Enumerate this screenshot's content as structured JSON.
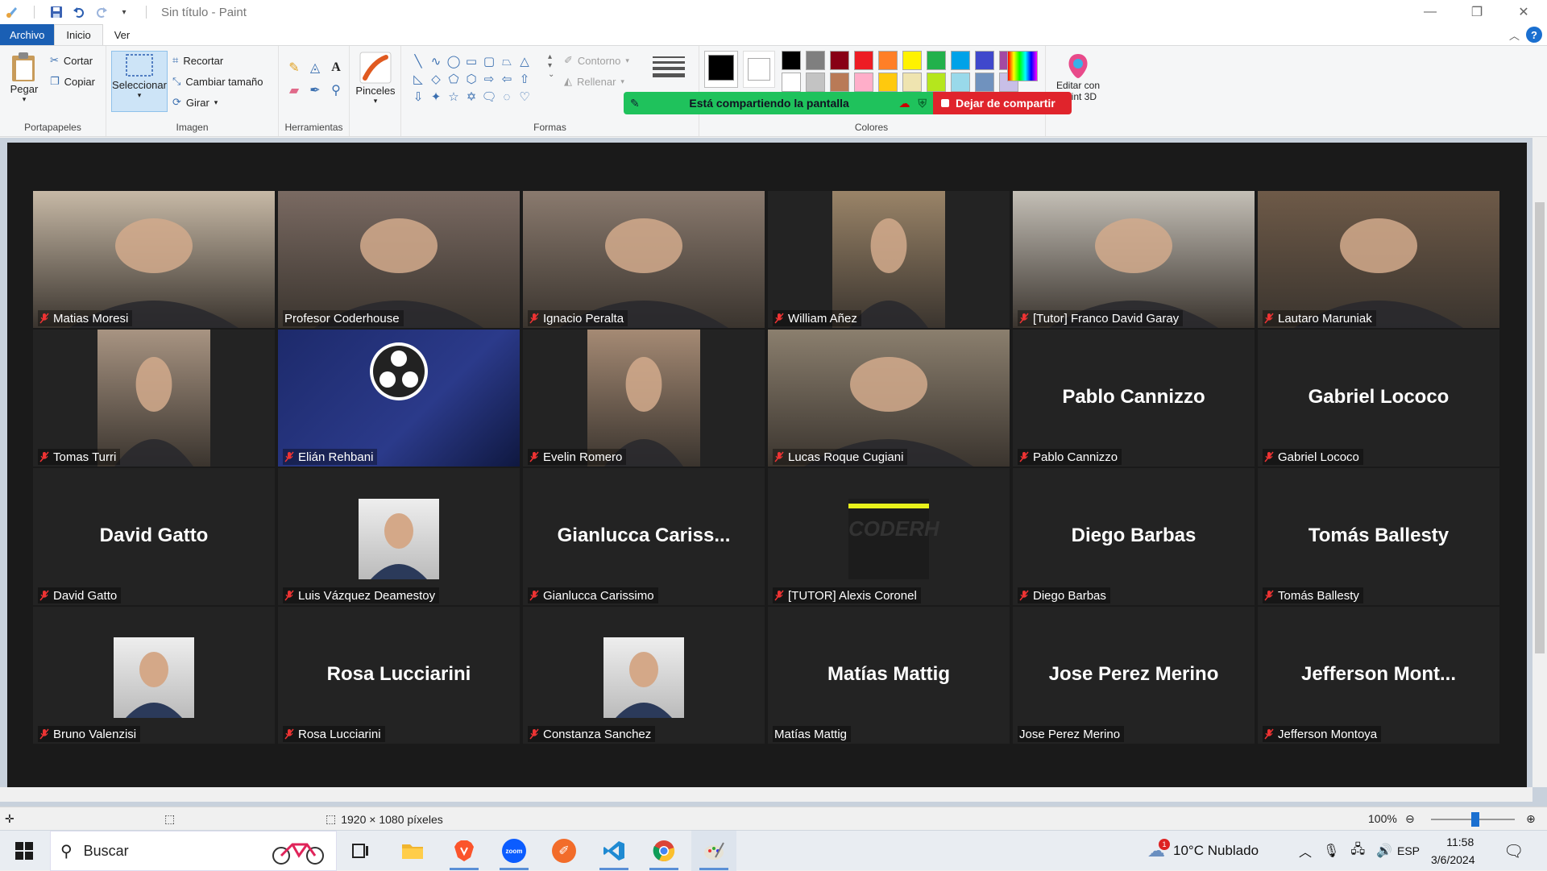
{
  "window": {
    "title": "Sin título - Paint",
    "controls": {
      "minimize": "—",
      "maximize": "❐",
      "close": "✕"
    }
  },
  "ribbon": {
    "tabs": [
      "Archivo",
      "Inicio",
      "Ver"
    ],
    "portapapeles": {
      "label": "Portapapeles",
      "paste": "Pegar",
      "cut": "Cortar",
      "copy": "Copiar"
    },
    "imagen": {
      "label": "Imagen",
      "select": "Seleccionar",
      "crop": "Recortar",
      "resize": "Cambiar tamaño",
      "rotate": "Girar"
    },
    "herramientas": {
      "label": "Herramientas"
    },
    "pinceles": "Pinceles",
    "formas": {
      "label": "Formas",
      "outline": "Contorno",
      "fill": "Rellenar"
    },
    "colores": {
      "label": "Colores"
    },
    "paint3d": "Editar con Paint 3D",
    "palette": [
      "#000000",
      "#7f7f7f",
      "#880015",
      "#ed1c24",
      "#ff7f27",
      "#fff200",
      "#22b14c",
      "#00a2e8",
      "#3f48cc",
      "#a349a4",
      "#ffffff",
      "#c3c3c3",
      "#b97a57",
      "#ffaec9",
      "#ffc90e",
      "#efe4b0",
      "#b5e61d",
      "#99d9ea",
      "#7092be",
      "#c8bfe7"
    ],
    "color1": "#000000",
    "color2": "#ffffff"
  },
  "share_banner": {
    "status": "Está compartiendo la pantalla",
    "stop": "Dejar de compartir"
  },
  "zoom_meeting": {
    "participants": [
      {
        "name": "Matias Moresi",
        "video": true,
        "muted": true
      },
      {
        "name": "Profesor Coderhouse",
        "video": true,
        "muted": false
      },
      {
        "name": "Ignacio Peralta",
        "video": true,
        "muted": true
      },
      {
        "name": "William Añez",
        "video": true,
        "muted": true
      },
      {
        "name": "[Tutor] Franco David Garay",
        "video": true,
        "muted": true
      },
      {
        "name": "Lautaro Maruniak",
        "video": true,
        "muted": true
      },
      {
        "name": "Tomas Turri",
        "video": true,
        "muted": true
      },
      {
        "name": "Elián Rehbani",
        "video": true,
        "muted": true
      },
      {
        "name": "Evelin Romero",
        "video": true,
        "muted": true
      },
      {
        "name": "Lucas Roque Cugiani",
        "video": true,
        "muted": true,
        "active_speaker": true
      },
      {
        "name": "Pablo Cannizzo",
        "big_name": "Pablo Cannizzo",
        "video": false,
        "muted": true
      },
      {
        "name": "Gabriel Lococo",
        "big_name": "Gabriel Lococo",
        "video": false,
        "muted": true
      },
      {
        "name": "David Gatto",
        "big_name": "David Gatto",
        "video": false,
        "muted": true
      },
      {
        "name": "Luis Vázquez Deamestoy",
        "video": false,
        "photo": true,
        "muted": true
      },
      {
        "name": "Gianlucca Carissimo",
        "big_name": "Gianlucca  Cariss...",
        "video": false,
        "muted": true
      },
      {
        "name": "[TUTOR] Alexis Coronel",
        "video": false,
        "photo": true,
        "photo_text": "CODERH",
        "muted": true
      },
      {
        "name": "Diego Barbas",
        "big_name": "Diego Barbas",
        "video": false,
        "muted": true
      },
      {
        "name": "Tomás Ballesty",
        "big_name": "Tomás Ballesty",
        "video": false,
        "muted": true
      },
      {
        "name": "Bruno Valenzisi",
        "video": false,
        "photo": true,
        "muted": true
      },
      {
        "name": "Rosa Lucciarini",
        "big_name": "Rosa Lucciarini",
        "video": false,
        "muted": true
      },
      {
        "name": "Constanza Sanchez",
        "video": false,
        "photo": true,
        "muted": true
      },
      {
        "name": "Matías Mattig",
        "big_name": "Matías Mattig",
        "video": false,
        "muted": false
      },
      {
        "name": "Jose Perez Merino",
        "big_name": "Jose Perez Merino",
        "video": false,
        "muted": false
      },
      {
        "name": "Jefferson Montoya",
        "big_name": "Jefferson  Mont...",
        "video": false,
        "muted": true
      }
    ]
  },
  "statusbar": {
    "dimensions": "1920 × 1080 píxeles",
    "zoom": "100%"
  },
  "taskbar": {
    "search_placeholder": "Buscar",
    "weather": "10°C  Nublado",
    "language": "ESP",
    "time": "11:58",
    "date": "3/6/2024",
    "apps": [
      "task-view",
      "file-explorer",
      "brave",
      "zoom",
      "swift-app",
      "vscode",
      "chrome",
      "paint"
    ]
  }
}
